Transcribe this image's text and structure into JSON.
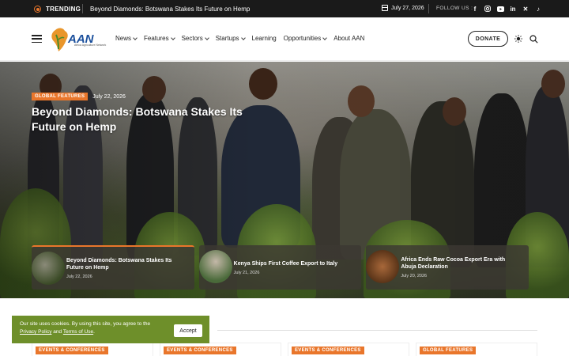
{
  "topbar": {
    "trending_label": "TRENDING",
    "trending_text": "Beyond Diamonds: Botswana Stakes Its Future on Hemp",
    "date": "July 27, 2026",
    "follow_label": "FOLLOW US :",
    "socials": [
      "facebook-icon",
      "instagram-icon",
      "youtube-icon",
      "linkedin-icon",
      "x-icon",
      "tiktok-icon"
    ]
  },
  "header": {
    "logo_text": "AAN",
    "logo_sub": "Africa Agriculture Network",
    "nav": [
      {
        "label": "News",
        "dropdown": true
      },
      {
        "label": "Features",
        "dropdown": true
      },
      {
        "label": "Sectors",
        "dropdown": true
      },
      {
        "label": "Startups",
        "dropdown": true
      },
      {
        "label": "Learning",
        "dropdown": false
      },
      {
        "label": "Opportunities",
        "dropdown": true
      },
      {
        "label": "About AAN",
        "dropdown": false
      }
    ],
    "donate_label": "DONATE"
  },
  "hero": {
    "category": "GLOBAL FEATURES",
    "date": "July 22, 2026",
    "title": "Beyond Diamonds: Botswana Stakes Its Future on Hemp"
  },
  "cards": [
    {
      "title": "Beyond Diamonds: Botswana Stakes Its Future on Hemp",
      "date": "July 22, 2026"
    },
    {
      "title": "Kenya Ships First Coffee Export to Italy",
      "date": "July 21, 2026"
    },
    {
      "title": "Africa Ends Raw Cocoa Export Era with Abuja Declaration",
      "date": "July 20, 2026"
    }
  ],
  "section_badges": [
    "EVENTS & CONFERENCES",
    "EVENTS & CONFERENCES",
    "EVENTS & CONFERENCES",
    "GLOBAL FEATURES"
  ],
  "cookie": {
    "text_before": "Our site uses cookies. By using this site, you agree to the",
    "privacy_label": "Privacy Policy",
    "and_text": "and",
    "terms_label": "Terms of Use",
    "period": ".",
    "accept_label": "Accept"
  },
  "colors": {
    "accent": "#e9762b",
    "topbar_bg": "#1a1a1a",
    "cookie_bg": "#6e8f2a"
  }
}
